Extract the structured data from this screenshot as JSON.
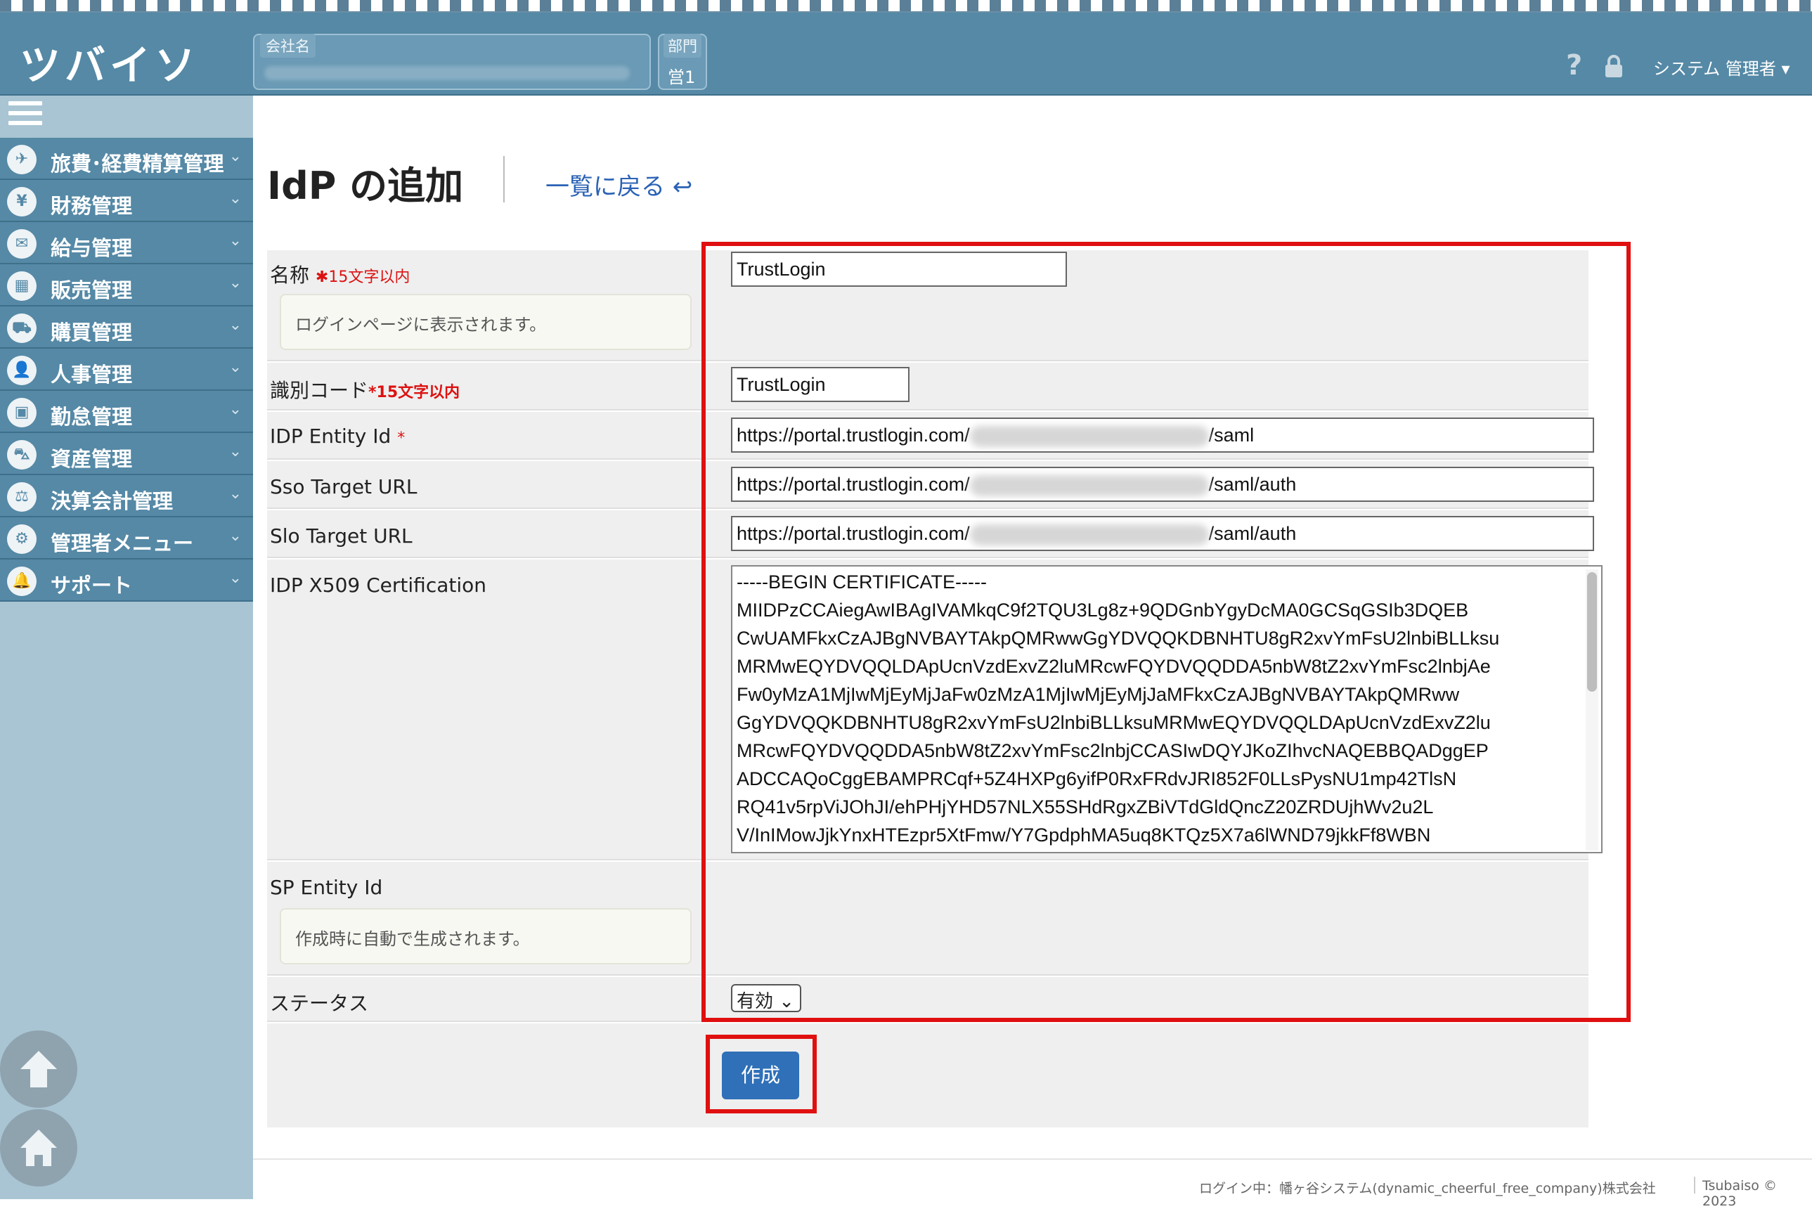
{
  "header": {
    "logo": "ツバイソ",
    "company_label": "会社名",
    "dept_label": "部門",
    "dept_value": "営1",
    "help": "?",
    "user_menu": "システム 管理者 ▾"
  },
  "sidebar": {
    "items": [
      {
        "label": "旅費･経費精算管理",
        "icon": "airplane-icon"
      },
      {
        "label": "財務管理",
        "icon": "yen-icon"
      },
      {
        "label": "給与管理",
        "icon": "envelope-icon"
      },
      {
        "label": "販売管理",
        "icon": "grid-icon"
      },
      {
        "label": "購買管理",
        "icon": "cart-icon"
      },
      {
        "label": "人事管理",
        "icon": "person-icon"
      },
      {
        "label": "勤怠管理",
        "icon": "calendar-icon"
      },
      {
        "label": "資産管理",
        "icon": "car-icon"
      },
      {
        "label": "決算会計管理",
        "icon": "balance-sheet-icon"
      },
      {
        "label": "管理者メニュー",
        "icon": "gears-icon"
      },
      {
        "label": "サポート",
        "icon": "bell-icon"
      }
    ]
  },
  "page": {
    "title": "IdP の追加",
    "back_link": "一覧に戻る ↩"
  },
  "form": {
    "name": {
      "label": "名称",
      "req": "✱15文字以内",
      "hint": "ログインページに表示されます。",
      "value": "TrustLogin"
    },
    "code": {
      "label": "識別コード",
      "req": "*15文字以内",
      "value": "TrustLogin"
    },
    "entity_id": {
      "label": "IDP Entity Id",
      "req": "*",
      "prefix": "https://portal.trustlogin.com/",
      "suffix": "/saml"
    },
    "sso_url": {
      "label": "Sso Target URL",
      "prefix": "https://portal.trustlogin.com/",
      "suffix": "/saml/auth"
    },
    "slo_url": {
      "label": "Slo Target URL",
      "prefix": "https://portal.trustlogin.com/",
      "suffix": "/saml/auth"
    },
    "cert": {
      "label": "IDP X509 Certification",
      "lines": [
        "-----BEGIN CERTIFICATE-----",
        "MIIDPzCCAiegAwIBAgIVAMkqC9f2TQU3Lg8z+9QDGnbYgyDcMA0GCSqGSIb3DQEB",
        "CwUAMFkxCzAJBgNVBAYTAkpQMRwwGgYDVQQKDBNHTU8gR2xvYmFsU2lnbiBLLksu",
        "MRMwEQYDVQQLDApUcnVzdExvZ2luMRcwFQYDVQQDDA5nbW8tZ2xvYmFsc2lnbjAe",
        "Fw0yMzA1MjIwMjEyMjJaFw0zMzA1MjIwMjEyMjJaMFkxCzAJBgNVBAYTAkpQMRww",
        "GgYDVQQKDBNHTU8gR2xvYmFsU2lnbiBLLksuMRMwEQYDVQQLDApUcnVzdExvZ2lu",
        "MRcwFQYDVQQDDA5nbW8tZ2xvYmFsc2lnbjCCASIwDQYJKoZIhvcNAQEBBQADggEP",
        "ADCCAQoCggEBAMPRCqf+5Z4HXPg6yifP0RxFRdvJRI852F0LLsPysNU1mp42TlsN",
        "RQ41v5rpViJOhJI/ehPHjYHD57NLX55SHdRgxZBiVTdGldQncZ20ZRDUjhWv2u2L",
        "V/InIMowJjkYnxHTEzpr5XtFmw/Y7GpdphMA5uq8KTQz5X7a6lWND79jkkFf8WBN"
      ]
    },
    "sp_entity": {
      "label": "SP Entity Id",
      "hint": "作成時に自動で生成されます。"
    },
    "status": {
      "label": "ステータス",
      "value": "有効"
    },
    "submit": "作成"
  },
  "footer": {
    "login": "ログイン中：幡ヶ谷システム(dynamic_cheerful_free_company)株式会社",
    "copyright": "Tsubaiso © 2023"
  },
  "colors": {
    "header": "#5589a6",
    "sidebar": "#a9c5d3",
    "accent": "#2f70b8",
    "highlight": "#e01010"
  }
}
